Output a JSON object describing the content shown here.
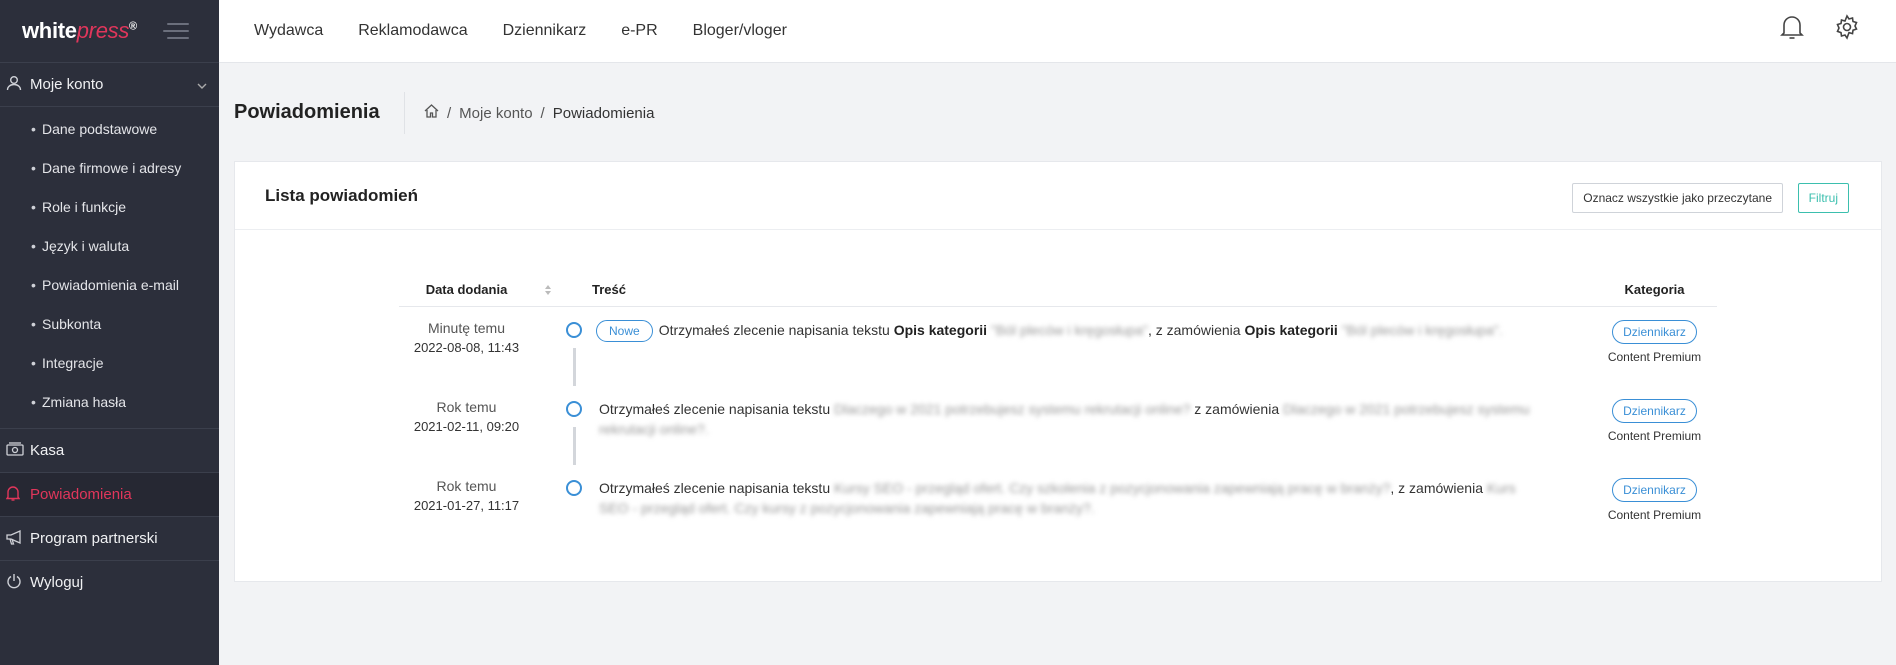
{
  "brand": {
    "logo_main": "white",
    "logo_accent": "press",
    "logo_mark": "®"
  },
  "sidebar": {
    "account_label": "Moje konto",
    "subitems": [
      "Dane podstawowe",
      "Dane firmowe i adresy",
      "Role i funkcje",
      "Język i waluta",
      "Powiadomienia e-mail",
      "Subkonta",
      "Integracje",
      "Zmiana hasła"
    ],
    "kasa_label": "Kasa",
    "notifications_label": "Powiadomienia",
    "partner_label": "Program partnerski",
    "logout_label": "Wyloguj"
  },
  "topnav": {
    "items": [
      "Wydawca",
      "Reklamodawca",
      "Dziennikarz",
      "e-PR",
      "Bloger/vloger"
    ]
  },
  "page": {
    "title": "Powiadomienia",
    "breadcrumb": {
      "sep": "/",
      "account": "Moje konto",
      "current": "Powiadomienia"
    }
  },
  "card": {
    "title": "Lista powiadomień",
    "mark_all_label": "Oznacz wszystkie jako przeczytane",
    "filter_label": "Filtruj"
  },
  "table": {
    "headers": {
      "date": "Data dodania",
      "content": "Treść",
      "category": "Kategoria"
    },
    "rows": [
      {
        "relative": "Minutę temu",
        "date": "2022-08-08, 11:43",
        "badge": "Nowe",
        "text1": "Otrzymałeś zlecenie napisania tekstu ",
        "bold1": "Opis kategorii",
        "blur1": " \"Ból pleców i kręgosłupa\"",
        "text2": ", z zamówienia ",
        "bold2": "Opis kategorii",
        "blur2": " \"Ból pleców i kręgosłupa\".",
        "category": "Dziennikarz",
        "category_sub": "Content Premium"
      },
      {
        "relative": "Rok temu",
        "date": "2021-02-11, 09:20",
        "text1": "Otrzymałeś zlecenie napisania tekstu ",
        "blur1": "Dlaczego w 2021 potrzebujesz systemu rekrutacji online?",
        "text2": " z zamówienia ",
        "blur2": "Dlaczego w 2021 potrzebujesz systemu rekrutacji online?.",
        "category": "Dziennikarz",
        "category_sub": "Content Premium"
      },
      {
        "relative": "Rok temu",
        "date": "2021-01-27, 11:17",
        "text1": "Otrzymałeś zlecenie napisania tekstu ",
        "blur1": "Kursy SEO - przegląd ofert. Czy szkolenia z pozycjonowania zapewniają pracę w branży?",
        "text2": ", z zamówienia ",
        "blur2": "Kurs SEO - przegląd ofert. Czy kursy z pozycjonowania zapewniają pracę w branży?.",
        "category": "Dziennikarz",
        "category_sub": "Content Premium"
      }
    ]
  },
  "colors": {
    "sidebar_bg": "#2c2f3b",
    "accent_red": "#e0365b",
    "accent_blue": "#3a8fd6",
    "accent_teal": "#3bbfae"
  }
}
